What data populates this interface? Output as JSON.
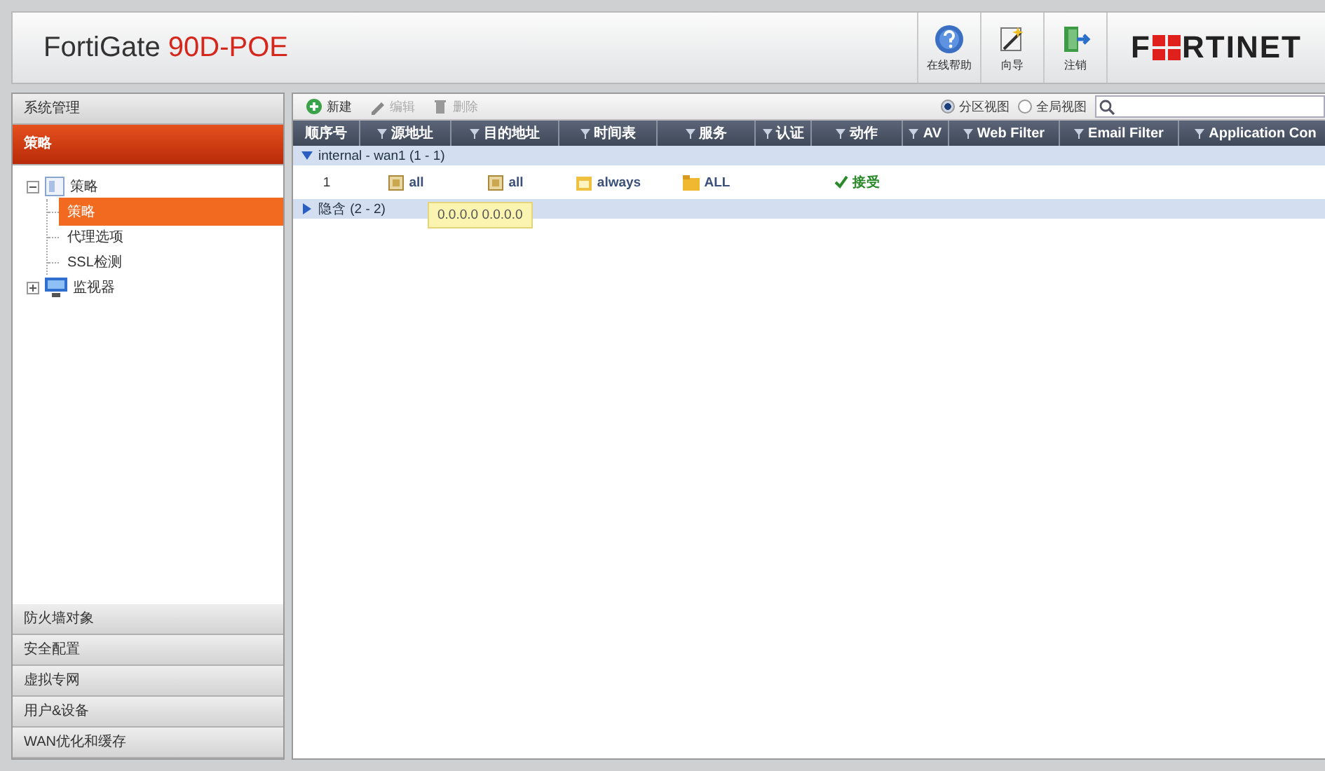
{
  "header": {
    "product": "FortiGate",
    "model": "90D-POE",
    "tools": [
      {
        "kind": "help",
        "label": "在线帮助"
      },
      {
        "kind": "wizard",
        "label": "向导"
      },
      {
        "kind": "logout",
        "label": "注销"
      }
    ],
    "logo": {
      "before": "F",
      "after": "RTINET"
    }
  },
  "sidebar": {
    "sections_top": [
      {
        "label": "系统管理",
        "selected": false
      },
      {
        "label": "策略",
        "selected": true
      }
    ],
    "tree": [
      {
        "label": "策略",
        "kind": "folder",
        "expanded": true,
        "children": [
          {
            "label": "策略",
            "selected": true
          },
          {
            "label": "代理选项",
            "selected": false
          },
          {
            "label": "SSL检测",
            "selected": false
          }
        ]
      },
      {
        "label": "监视器",
        "kind": "monitor",
        "expanded": false
      }
    ],
    "sections_bottom": [
      {
        "label": "防火墙对象",
        "selected": false
      },
      {
        "label": "安全配置",
        "selected": false
      },
      {
        "label": "虚拟专网",
        "selected": false
      },
      {
        "label": "用户&设备",
        "selected": false
      },
      {
        "label": "WAN优化和缓存",
        "selected": false
      }
    ]
  },
  "toolbar": {
    "buttons": [
      {
        "kind": "new",
        "label": "新建",
        "disabled": false
      },
      {
        "kind": "edit",
        "label": "编辑",
        "disabled": true
      },
      {
        "kind": "delete",
        "label": "删除",
        "disabled": true
      }
    ],
    "views": [
      {
        "label": "分区视图",
        "selected": true
      },
      {
        "label": "全局视图",
        "selected": false
      }
    ]
  },
  "table": {
    "columns": [
      {
        "label": "顺序号",
        "filter": false
      },
      {
        "label": "源地址",
        "filter": true
      },
      {
        "label": "目的地址",
        "filter": true
      },
      {
        "label": "时间表",
        "filter": true
      },
      {
        "label": "服务",
        "filter": true
      },
      {
        "label": "认证",
        "filter": true
      },
      {
        "label": "动作",
        "filter": true
      },
      {
        "label": "AV",
        "filter": true
      },
      {
        "label": "Web Filter",
        "filter": true
      },
      {
        "label": "Email Filter",
        "filter": true
      },
      {
        "label": "Application Con",
        "filter": true
      }
    ],
    "groups": [
      {
        "label": "internal - wan1 (1 - 1)",
        "expanded": true,
        "rows": [
          {
            "cells": [
              {
                "kind": "number",
                "text": "1"
              },
              {
                "kind": "address",
                "text": "all"
              },
              {
                "kind": "address",
                "text": "all"
              },
              {
                "kind": "schedule",
                "text": "always"
              },
              {
                "kind": "service",
                "text": "ALL"
              },
              {
                "kind": "empty"
              },
              {
                "kind": "action",
                "text": "接受"
              }
            ]
          }
        ]
      },
      {
        "label": "隐含 (2 - 2)",
        "expanded": false
      }
    ]
  },
  "tooltip": "0.0.0.0 0.0.0.0"
}
